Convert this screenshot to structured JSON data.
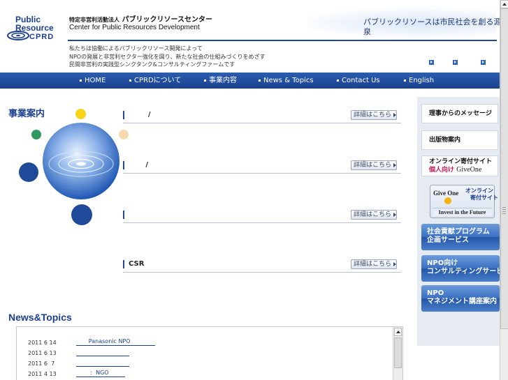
{
  "header": {
    "logo_lines": [
      "Public",
      "Resource",
      "CPRD"
    ],
    "org_prefix": "特定非営利活動法人",
    "org_name_jp": "パブリックリソースセンター",
    "org_name_en": "Center for Public Resources Development",
    "tagline": "パブリックリソースは市民社会を創る源泉",
    "intro_lines": [
      "私たちは協働によるパブリックリソース開発によって",
      "NPOの発展と非営利セクター強化を図り、新たな社会の仕組みづくりをめざす",
      "民間非営利の実践型シンクタンク&コンサルティングファームです"
    ]
  },
  "nav": {
    "items": [
      {
        "label": "HOME"
      },
      {
        "label": "CPRDについて"
      },
      {
        "label": "事業内容"
      },
      {
        "label": "News & Topics"
      },
      {
        "label": "Contact Us"
      },
      {
        "label": "English"
      }
    ]
  },
  "services": {
    "title": "事業案内",
    "detail_label": "詳細はこちら",
    "rows": [
      {
        "label": "        /"
      },
      {
        "label": "       /"
      },
      {
        "label": ""
      },
      {
        "label": "CSR"
      }
    ]
  },
  "news": {
    "title": "News&Topics",
    "items": [
      {
        "date": "2011 6 14",
        "link": "       Panasonic NPO              "
      },
      {
        "date": "2011 6 13",
        "link": "                              "
      },
      {
        "date": "2011 6  7",
        "link": "                              "
      },
      {
        "date": "2011 4 13",
        "link": "        :  NGO         "
      }
    ]
  },
  "sidebar": {
    "message_label": "理事からのメッセージ",
    "publications_label": "出版物案内",
    "online_donation": {
      "line1": "オンライン寄付サイト",
      "line2_pink": "個人向け",
      "line2_brand": "GiveOne"
    },
    "giveone_banner": {
      "brand": "Give One",
      "sub1": "オンライン",
      "sub2": "寄付サイト",
      "slogan": "Invest in the Future"
    },
    "blue_buttons": [
      {
        "line1": "社会貢献プログラム",
        "line2": "企画サービス"
      },
      {
        "line1": "NPO向け",
        "line2": "コンサルティングサービス"
      },
      {
        "line1": "NPO",
        "line2": "マネジメント講座案内"
      }
    ]
  },
  "colors": {
    "brand_blue": "#1a3f8f",
    "nav_blue": "#2b5eb1",
    "accent_yellow": "#f7d418",
    "accent_green": "#2e9a5f",
    "accent_pink": "#c2185b"
  }
}
